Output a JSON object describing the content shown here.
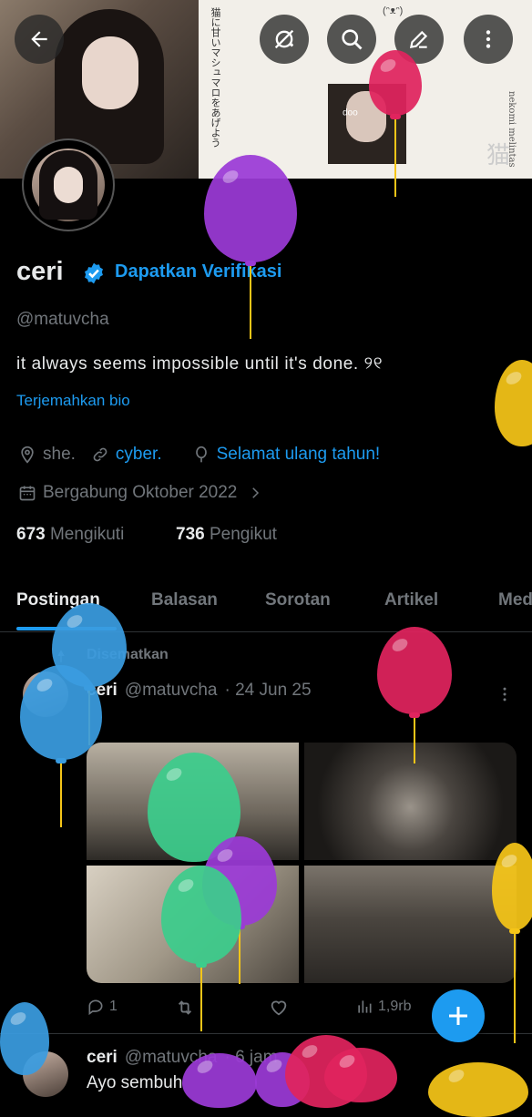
{
  "profile": {
    "name": "ceri",
    "get_verified": "Dapatkan Verifikasi",
    "handle": "@matuvcha",
    "bio": "it always seems impossible until it's done. ୨୧",
    "translate_bio": "Terjemahkan bio",
    "location": "she.",
    "website": "cyber.",
    "birthday": "Selamat ulang tahun!",
    "joined": "Bergabung Oktober 2022",
    "following_count": "673",
    "following_label": "Mengikuti",
    "followers_count": "736",
    "followers_label": "Pengikut"
  },
  "banner": {
    "jp_text": "猫に甘いマシュマロをあげよう",
    "kaomoji": "(ᵔᴥᵔ)",
    "tag": "nekomi melintas",
    "neko": "猫",
    "photo_caption": "oop"
  },
  "top_bar": {
    "icons": [
      "back-arrow-icon",
      "no-notify-icon",
      "search-icon",
      "edit-icon",
      "more-vertical-icon"
    ]
  },
  "tabs": [
    "Postingan",
    "Balasan",
    "Sorotan",
    "Artikel",
    "Media"
  ],
  "active_tab": "Postingan",
  "pinned_label": "Disematkan",
  "posts": [
    {
      "name": "ceri",
      "handle": "@matuvcha",
      "date": "· 24 Jun 25",
      "replies": "1",
      "views": "1,9rb"
    },
    {
      "name": "ceri",
      "handle": "@matuvcha",
      "date": "· 6 jam",
      "text": "Ayo sembuh"
    }
  ],
  "colors": {
    "accent": "#1d9bf0",
    "background": "#000000",
    "text_primary": "#e7e9ea",
    "text_secondary": "#71767b",
    "balloon_red": "#e0245e",
    "balloon_purple": "#9b3ad6",
    "balloon_blue": "#3a9ce0",
    "balloon_green": "#3ccc8c",
    "balloon_yellow": "#f5c518"
  }
}
